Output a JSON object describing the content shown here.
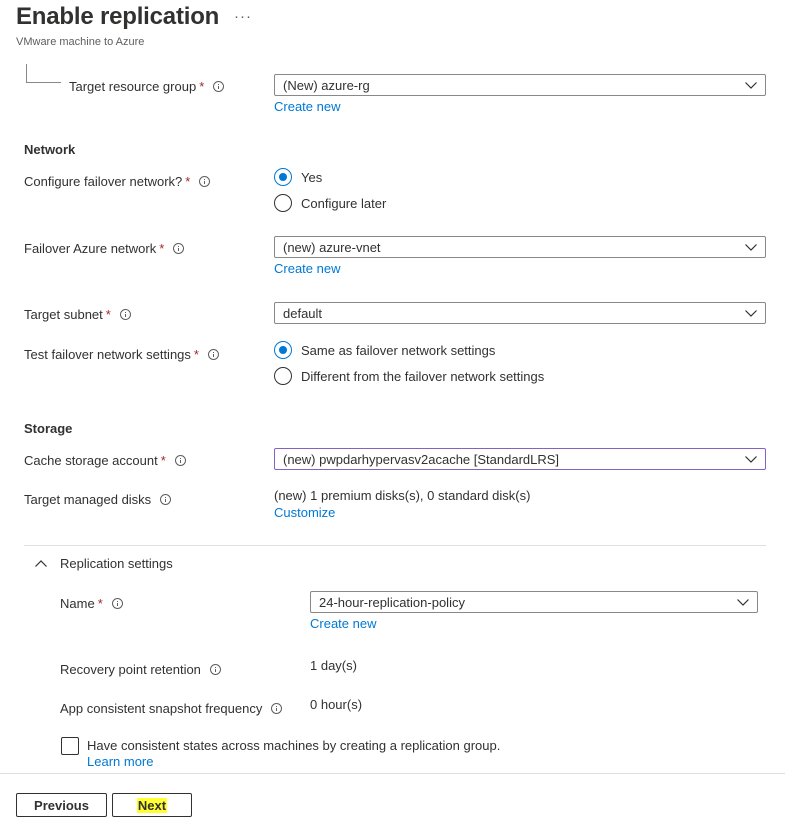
{
  "header": {
    "title": "Enable replication",
    "subtitle": "VMware machine to Azure",
    "more_label": "···"
  },
  "target_resource_group": {
    "label": "Target resource group",
    "value": "(New) azure-rg",
    "create_link": "Create new"
  },
  "network": {
    "heading": "Network",
    "configure_failover": {
      "label": "Configure failover network?",
      "options": [
        "Yes",
        "Configure later"
      ],
      "selected": "Yes"
    },
    "failover_network": {
      "label": "Failover Azure network",
      "value": "(new) azure-vnet",
      "create_link": "Create new"
    },
    "target_subnet": {
      "label": "Target subnet",
      "value": "default"
    },
    "test_failover": {
      "label": "Test failover network settings",
      "options": [
        "Same as failover network settings",
        "Different from the failover network settings"
      ],
      "selected": "Same as failover network settings"
    }
  },
  "storage": {
    "heading": "Storage",
    "cache_account": {
      "label": "Cache storage account",
      "value": "(new) pwpdarhypervasv2acache [StandardLRS]"
    },
    "managed_disks": {
      "label": "Target managed disks",
      "value": "(new) 1 premium disks(s), 0 standard disk(s)",
      "link": "Customize"
    }
  },
  "replication": {
    "heading": "Replication settings",
    "name": {
      "label": "Name",
      "value": "24-hour-replication-policy",
      "create_link": "Create new"
    },
    "retention": {
      "label": "Recovery point retention",
      "value": "1 day(s)"
    },
    "snapshot": {
      "label": "App consistent snapshot frequency",
      "value": "0 hour(s)"
    },
    "group_checkbox": {
      "label": "Have consistent states across machines by creating a replication group.",
      "checked": false,
      "link": "Learn more"
    }
  },
  "footer": {
    "previous_label": "Previous",
    "next_label": "Next"
  },
  "colors": {
    "accent": "#0078d4",
    "required": "#a4262c",
    "focus_border": "#8661c5",
    "highlight": "#ffff32"
  },
  "icons": [
    "more-icon",
    "info-icon",
    "chevron-down-icon",
    "chevron-up-icon",
    "radio-icon",
    "checkbox-icon"
  ]
}
